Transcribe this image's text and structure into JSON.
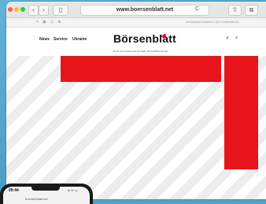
{
  "browser": {
    "url": "www.boersenblatt.net",
    "reload_icon": "C",
    "favorites_icons": "+ ◉ ◇ ⊕",
    "favorites_right": "meinbo(ek)s  Bookbites  Y(H)  Veröffentlichen"
  },
  "site": {
    "nav": [
      "News",
      "Service",
      "Ukraine"
    ],
    "logo": "Börsenblatt",
    "tagline": "DAS FACHMAGAZIN DER BUCHBRANCHE",
    "search_icon": "⌕",
    "user_icon": "♀",
    "ad_color": "#e8141c"
  },
  "phone": {
    "time": "09:44",
    "status": "▪▪ ᯤ ▭",
    "url": "boersenblatt.net"
  }
}
